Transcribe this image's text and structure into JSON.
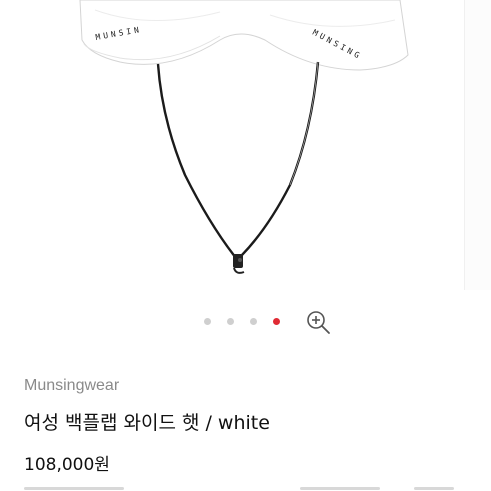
{
  "product": {
    "brand": "Munsingwear",
    "title": "여성 백플랩 와이드 햇 / white",
    "price": "108,000원"
  },
  "hat_print": {
    "left_brim": "MUNSIN",
    "right_brim": "MUNSING"
  },
  "gallery": {
    "slide_count": 4,
    "active_slide": 4,
    "active_color": "#e02a34",
    "inactive_color": "#cfcfcf"
  },
  "icons": {
    "zoom": "zoom-in-icon"
  }
}
